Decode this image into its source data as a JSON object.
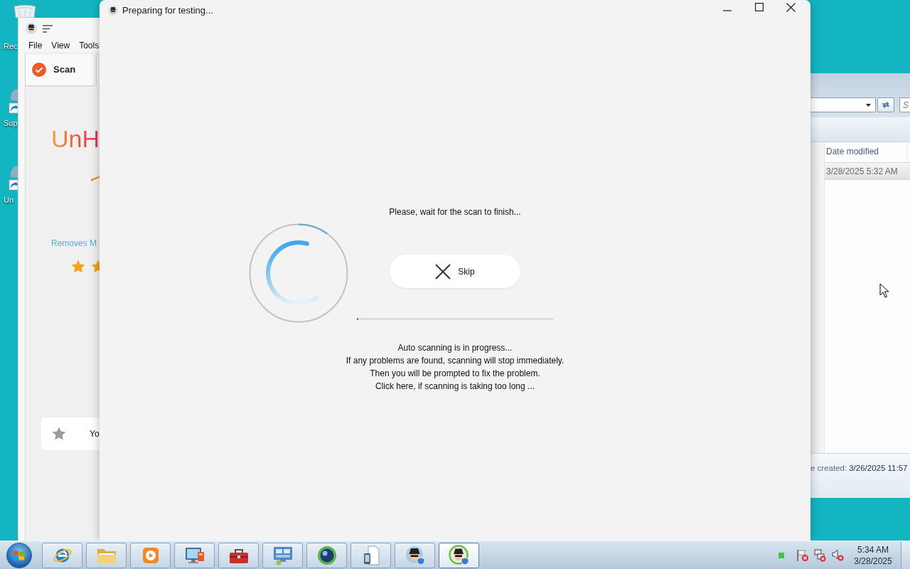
{
  "desktop": {
    "icons": [
      {
        "kind": "recycle_bin",
        "label": "Rec"
      },
      {
        "kind": "shortcut",
        "label": "Sup"
      },
      {
        "kind": "shortcut",
        "label": "Un"
      }
    ]
  },
  "background_window": {
    "menu": [
      "File",
      "View",
      "Tools"
    ],
    "tabs": [
      {
        "label": "Scan",
        "selected": true
      }
    ],
    "logo_text": "UnH",
    "tagline": "Removes M",
    "card_text": "Yo"
  },
  "dialog": {
    "title": "Preparing for testing...",
    "message": "Please, wait for the scan to finish...",
    "skip_button": "Skip",
    "progress": {
      "level": 0.01
    },
    "info_lines": [
      "Auto scanning is in progress...",
      "If any problems are found, scanning will stop immediately.",
      "Then you will be prompted to fix the problem.",
      "Click here, if scanning is taking too long ..."
    ]
  },
  "explorer": {
    "search_placeholder": "S",
    "columns": [
      "Date modified"
    ],
    "rows": [
      {
        "date_modified": "3/28/2025 5:32 AM",
        "selected": true
      }
    ],
    "details": {
      "label": "e created:",
      "value": "3/26/2025 11:57"
    }
  },
  "taskbar": {
    "apps": [
      {
        "kind": "browser",
        "selected": false
      },
      {
        "kind": "folder",
        "selected": false
      },
      {
        "kind": "media",
        "selected": false
      },
      {
        "kind": "monitor",
        "selected": false
      },
      {
        "kind": "toolbox",
        "selected": false
      },
      {
        "kind": "control_panel",
        "selected": false
      },
      {
        "kind": "sphere",
        "selected": false
      },
      {
        "kind": "device",
        "selected": false
      },
      {
        "kind": "avatar",
        "selected": false
      },
      {
        "kind": "avatar_ring",
        "selected": true
      }
    ],
    "clock": {
      "time": "5:34 AM",
      "date": "3/28/2025"
    }
  }
}
